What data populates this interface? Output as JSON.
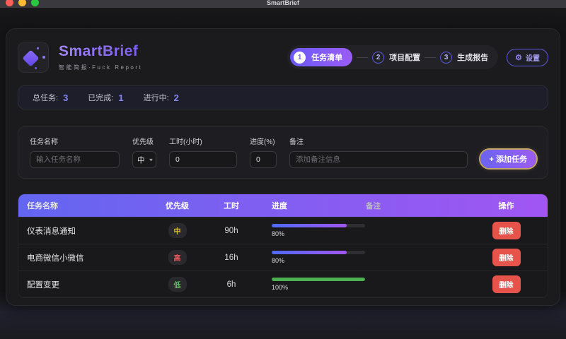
{
  "window": {
    "title": "SmartBrief"
  },
  "header": {
    "app_title": "SmartBrief",
    "app_subtitle": "智能简报·Fuck Report",
    "steps": [
      {
        "num": "1",
        "label": "任务清单"
      },
      {
        "num": "2",
        "label": "项目配置"
      },
      {
        "num": "3",
        "label": "生成报告"
      }
    ],
    "settings_label": "设置"
  },
  "stats": [
    {
      "label": "总任务:",
      "value": "3"
    },
    {
      "label": "已完成:",
      "value": "1"
    },
    {
      "label": "进行中:",
      "value": "2"
    }
  ],
  "form": {
    "task_name_label": "任务名称",
    "task_name_placeholder": "输入任务名称",
    "priority_label": "优先级",
    "priority_value": "中",
    "hours_label": "工时(小时)",
    "hours_value": "0",
    "progress_label": "进度(%)",
    "progress_value": "0",
    "note_label": "备注",
    "note_placeholder": "添加备注信息",
    "add_button_label": "+ 添加任务"
  },
  "table": {
    "headers": [
      "任务名称",
      "优先级",
      "工时",
      "进度",
      "备注",
      "操作"
    ],
    "rows": [
      {
        "name": "仪表消息通知",
        "priority": "中",
        "priority_color": "#e2b93d",
        "hours": "90h",
        "progress": 80,
        "progress_label": "80%",
        "note": "",
        "bar_type": "gradient",
        "action": "删除"
      },
      {
        "name": "电商微信小微信",
        "priority": "高",
        "priority_color": "#e05b5b",
        "hours": "16h",
        "progress": 80,
        "progress_label": "80%",
        "note": "",
        "bar_type": "gradient",
        "action": "删除"
      },
      {
        "name": "配置变更",
        "priority": "低",
        "priority_color": "#5cbf60",
        "hours": "6h",
        "progress": 100,
        "progress_label": "100%",
        "note": "",
        "bar_type": "green",
        "action": "删除"
      }
    ]
  },
  "colors": {
    "accent_indigo": "#6366f1",
    "accent_purple": "#a156f2",
    "gold_ring": "#e0ba73",
    "delete_red": "#e5534b",
    "progress_green": "#4caf50",
    "traffic_red": "#ff5f57",
    "traffic_yellow": "#febc2e",
    "traffic_green": "#28c840"
  }
}
